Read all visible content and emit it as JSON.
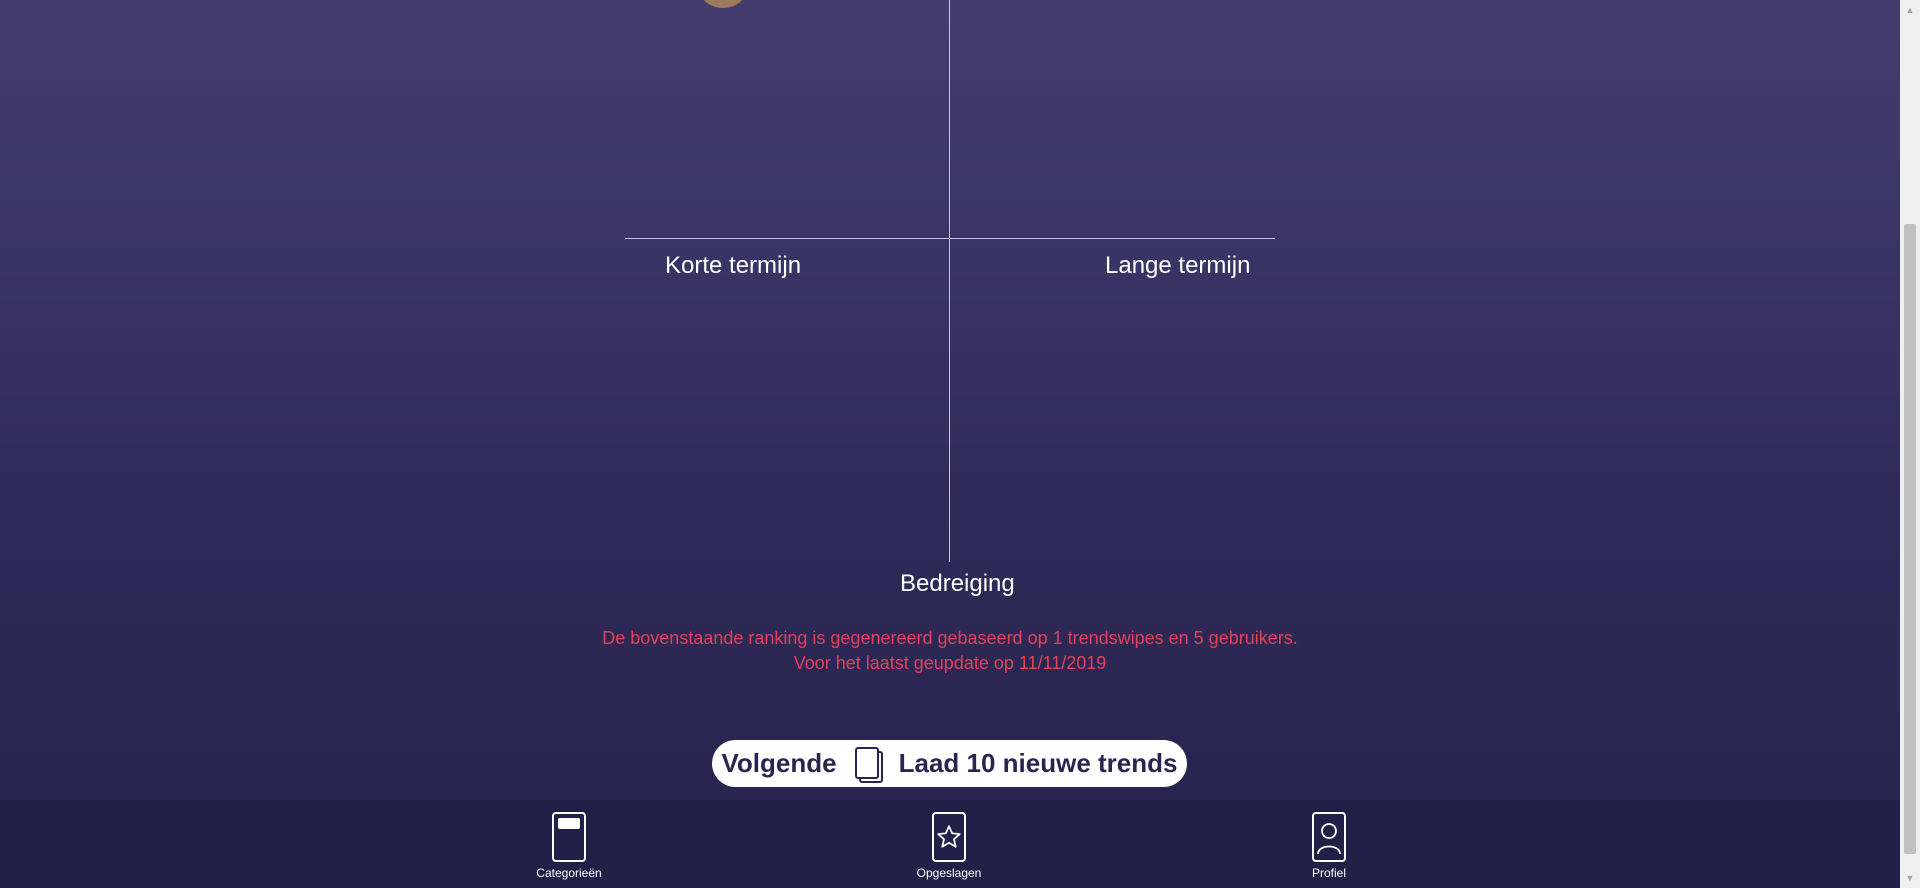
{
  "matrix": {
    "label_left": "Korte termijn",
    "label_right": "Lange termijn",
    "label_bottom": "Bedreiging"
  },
  "note": {
    "line1": "De bovenstaande ranking is gegenereerd gebaseerd op 1 trendswipes en 5 gebruikers.",
    "line2": "Voor het laatst geupdate op 11/11/2019"
  },
  "next_button": {
    "label_left": "Volgende",
    "icon": "cards-icon",
    "label_right": "Laad 10 nieuwe trends"
  },
  "bottom_nav": {
    "items": [
      {
        "label": "Categorieën",
        "icon": "category-card-icon"
      },
      {
        "label": "Opgeslagen",
        "icon": "star-icon"
      },
      {
        "label": "Profiel",
        "icon": "profile-icon"
      }
    ]
  },
  "colors": {
    "background_top": "#443c6e",
    "background_bottom": "#28224d",
    "note_text": "#e5405a",
    "dot": "#9c7a5a",
    "nav_background": "#241f47"
  }
}
